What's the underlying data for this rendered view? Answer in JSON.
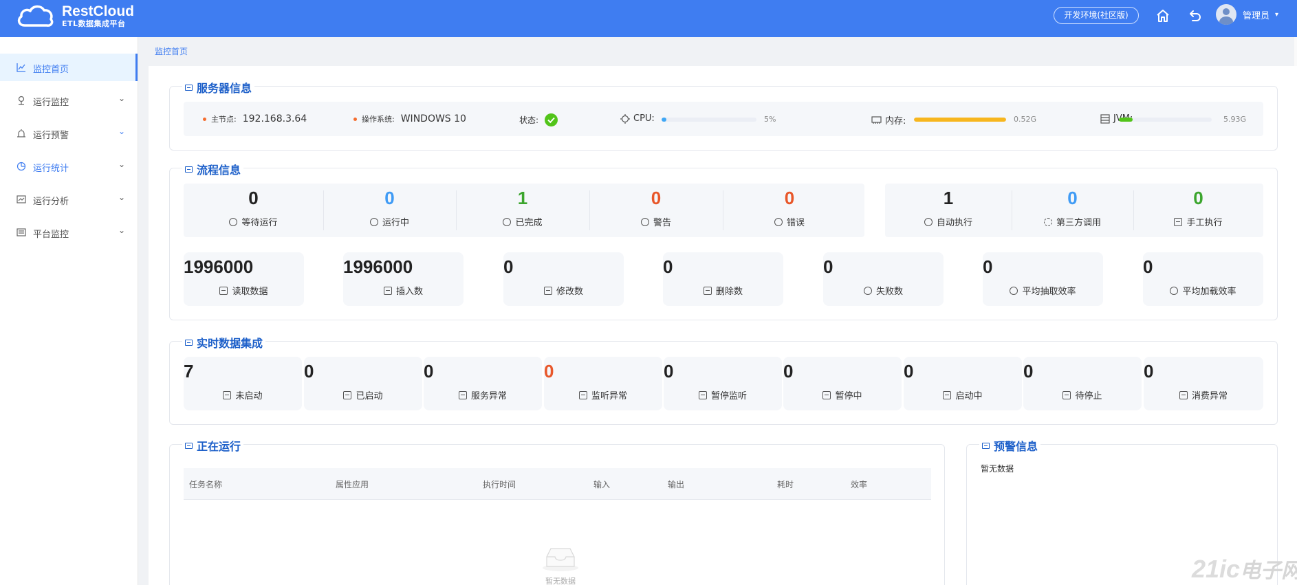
{
  "brand": {
    "name": "RestCloud",
    "subtitle": "ETL数据集成平台"
  },
  "header": {
    "env_button": "开发环境(社区版)",
    "user_name": "管理员",
    "caret": "▾"
  },
  "sidebar": {
    "items": [
      {
        "label": "监控首页",
        "icon": "chart-line-icon",
        "active": true
      },
      {
        "label": "运行监控",
        "icon": "monitor-icon",
        "arrow": "⌄"
      },
      {
        "label": "运行预警",
        "icon": "alarm-icon",
        "arrow": "⌄"
      },
      {
        "label": "运行统计",
        "icon": "pie-chart-icon",
        "arrow": "⌄"
      },
      {
        "label": "运行分析",
        "icon": "analysis-icon",
        "arrow": "⌄"
      },
      {
        "label": "平台监控",
        "icon": "platform-icon",
        "arrow": "⌄"
      }
    ]
  },
  "breadcrumb": "监控首页",
  "server": {
    "title": "服务器信息",
    "node_label": "主节点:",
    "node_value": "192.168.3.64",
    "os_label": "操作系统:",
    "os_value": "WINDOWS 10",
    "status_label": "状态:",
    "cpu_label": "CPU:",
    "cpu_value": "5%",
    "cpu_percent": 5,
    "mem_label": "内存:",
    "mem_value": "0.52G",
    "mem_percent": 100,
    "jvm_label": "JVM:",
    "jvm_value": "5.93G",
    "jvm_percent": 15,
    "colors": {
      "cpu": "#3fa7f5",
      "mem": "#f7b61e",
      "jvm": "#52c41a"
    }
  },
  "flow": {
    "title": "流程信息",
    "status": [
      {
        "value": "0",
        "label": "等待运行",
        "color": "black",
        "icon": "clock-icon"
      },
      {
        "value": "0",
        "label": "运行中",
        "color": "blue",
        "icon": "loading-icon"
      },
      {
        "value": "1",
        "label": "已完成",
        "color": "green",
        "icon": "clock-icon"
      },
      {
        "value": "0",
        "label": "警告",
        "color": "orange",
        "icon": "warning-icon"
      },
      {
        "value": "0",
        "label": "错误",
        "color": "orange",
        "icon": "error-icon"
      }
    ],
    "modes": [
      {
        "value": "1",
        "label": "自动执行",
        "color": "black",
        "icon": "auto-icon"
      },
      {
        "value": "0",
        "label": "第三方调用",
        "color": "blue",
        "icon": "api-icon"
      },
      {
        "value": "0",
        "label": "手工执行",
        "color": "green",
        "icon": "edit-icon"
      }
    ],
    "metrics": [
      {
        "value": "1996000",
        "label": "读取数据",
        "icon": "read-icon"
      },
      {
        "value": "1996000",
        "label": "插入数",
        "icon": "insert-icon"
      },
      {
        "value": "0",
        "label": "修改数",
        "icon": "pencil-icon"
      },
      {
        "value": "0",
        "label": "删除数",
        "icon": "trash-icon"
      },
      {
        "value": "0",
        "label": "失败数",
        "icon": "fail-icon"
      },
      {
        "value": "0",
        "label": "平均抽取效率",
        "icon": "refresh-icon"
      },
      {
        "value": "0",
        "label": "平均加载效率",
        "icon": "refresh-icon"
      }
    ]
  },
  "realtime": {
    "title": "实时数据集成",
    "items": [
      {
        "value": "7",
        "label": "未启动",
        "color": "black"
      },
      {
        "value": "0",
        "label": "已启动",
        "color": "black"
      },
      {
        "value": "0",
        "label": "服务异常",
        "color": "black"
      },
      {
        "value": "0",
        "label": "监听异常",
        "color": "orange"
      },
      {
        "value": "0",
        "label": "暂停监听",
        "color": "black"
      },
      {
        "value": "0",
        "label": "暂停中",
        "color": "black"
      },
      {
        "value": "0",
        "label": "启动中",
        "color": "black"
      },
      {
        "value": "0",
        "label": "待停止",
        "color": "black"
      },
      {
        "value": "0",
        "label": "消费异常",
        "color": "black"
      }
    ]
  },
  "running": {
    "title": "正在运行",
    "columns": [
      "任务名称",
      "属性应用",
      "执行时间",
      "输入",
      "输出",
      "耗时",
      "效率"
    ],
    "empty_text": "暂无数据"
  },
  "alerts": {
    "title": "预警信息",
    "empty_text": "暂无数据"
  },
  "watermark": {
    "latin": "21ic",
    "cn": "电子网"
  }
}
